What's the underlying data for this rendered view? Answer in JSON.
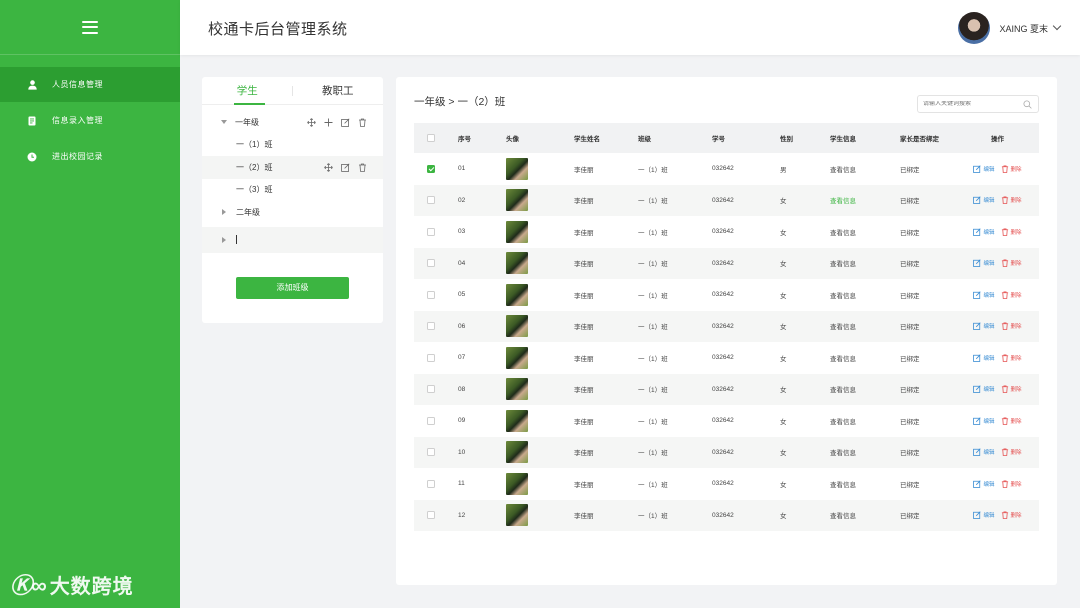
{
  "app": {
    "title": "校通卡后台管理系统"
  },
  "user": {
    "name": "XAING 夏末"
  },
  "sidebar": {
    "items": [
      {
        "label": "人员信息管理",
        "icon": "person-icon",
        "active": true
      },
      {
        "label": "信息录入管理",
        "icon": "document-icon",
        "active": false
      },
      {
        "label": "进出校园记录",
        "icon": "clock-icon",
        "active": false
      }
    ],
    "watermark": "大数跨境",
    "watermark_mark": "Ⓚ∞"
  },
  "tree": {
    "tabs": [
      {
        "label": "学生",
        "active": true
      },
      {
        "label": "教职工",
        "active": false
      }
    ],
    "grade1": "一年级",
    "classes": [
      "一（1）班",
      "一（2）班",
      "一（3）班"
    ],
    "grade2": "二年级",
    "add_button": "添加班级"
  },
  "main": {
    "breadcrumb": "一年级 > 一（2）班",
    "search_placeholder": "请输入关键词搜索"
  },
  "table": {
    "headers": {
      "no": "序号",
      "pic": "头像",
      "name": "学生姓名",
      "cls": "班级",
      "sid": "学号",
      "sex": "性别",
      "info": "学生信息",
      "bind": "家长是否绑定",
      "ops": "操作"
    },
    "edit_label": "编辑",
    "delete_label": "删除",
    "rows": [
      {
        "no": "01",
        "name": "李佳丽",
        "cls": "一（1）班",
        "sid": "032642",
        "sex": "男",
        "info": "查看信息",
        "bind": "已绑定",
        "checked": true,
        "info_green": false
      },
      {
        "no": "02",
        "name": "李佳丽",
        "cls": "一（1）班",
        "sid": "032642",
        "sex": "女",
        "info": "查看信息",
        "bind": "已绑定",
        "checked": false,
        "info_green": true
      },
      {
        "no": "03",
        "name": "李佳丽",
        "cls": "一（1）班",
        "sid": "032642",
        "sex": "女",
        "info": "查看信息",
        "bind": "已绑定",
        "checked": false,
        "info_green": false
      },
      {
        "no": "04",
        "name": "李佳丽",
        "cls": "一（1）班",
        "sid": "032642",
        "sex": "女",
        "info": "查看信息",
        "bind": "已绑定",
        "checked": false,
        "info_green": false
      },
      {
        "no": "05",
        "name": "李佳丽",
        "cls": "一（1）班",
        "sid": "032642",
        "sex": "女",
        "info": "查看信息",
        "bind": "已绑定",
        "checked": false,
        "info_green": false
      },
      {
        "no": "06",
        "name": "李佳丽",
        "cls": "一（1）班",
        "sid": "032642",
        "sex": "女",
        "info": "查看信息",
        "bind": "已绑定",
        "checked": false,
        "info_green": false
      },
      {
        "no": "07",
        "name": "李佳丽",
        "cls": "一（1）班",
        "sid": "032642",
        "sex": "女",
        "info": "查看信息",
        "bind": "已绑定",
        "checked": false,
        "info_green": false
      },
      {
        "no": "08",
        "name": "李佳丽",
        "cls": "一（1）班",
        "sid": "032642",
        "sex": "女",
        "info": "查看信息",
        "bind": "已绑定",
        "checked": false,
        "info_green": false
      },
      {
        "no": "09",
        "name": "李佳丽",
        "cls": "一（1）班",
        "sid": "032642",
        "sex": "女",
        "info": "查看信息",
        "bind": "已绑定",
        "checked": false,
        "info_green": false
      },
      {
        "no": "10",
        "name": "李佳丽",
        "cls": "一（1）班",
        "sid": "032642",
        "sex": "女",
        "info": "查看信息",
        "bind": "已绑定",
        "checked": false,
        "info_green": false
      },
      {
        "no": "11",
        "name": "李佳丽",
        "cls": "一（1）班",
        "sid": "032642",
        "sex": "女",
        "info": "查看信息",
        "bind": "已绑定",
        "checked": false,
        "info_green": false
      },
      {
        "no": "12",
        "name": "李佳丽",
        "cls": "一（1）班",
        "sid": "032642",
        "sex": "女",
        "info": "查看信息",
        "bind": "已绑定",
        "checked": false,
        "info_green": false
      }
    ]
  },
  "colors": {
    "brand": "#3cb541",
    "edit": "#3b8ed4",
    "delete": "#e55252"
  }
}
